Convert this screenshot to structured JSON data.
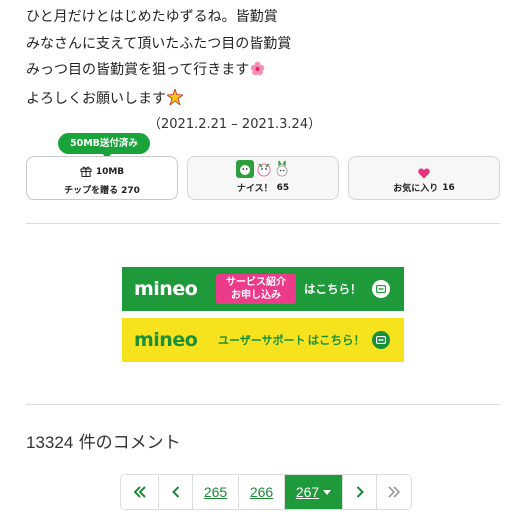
{
  "post": {
    "lines": [
      "ひと月だけとはじめたゆずるね。皆勤賞",
      "みなさんに支えて頂いたふたつ目の皆勤賞",
      "みっつ目の皆勤賞を狙って行きます",
      "よろしくお願いします"
    ],
    "period": "（2021.2.21 – 2021.3.24）"
  },
  "actions": {
    "sent_badge": "50MB送付済み",
    "tip": {
      "amount": "10MB",
      "label": "チップを贈る",
      "count": "270"
    },
    "nice": {
      "label": "ナイス！",
      "count": "65"
    },
    "favorite": {
      "label": "お気に入り",
      "count": "16"
    }
  },
  "banners": {
    "logo": "mineo",
    "service": {
      "box_line1": "サービス紹介",
      "box_line2": "お申し込み",
      "cta": "はこちら！"
    },
    "support": {
      "label": "ユーザーサポート",
      "cta": "はこちら！"
    }
  },
  "comments": {
    "count": "13324",
    "suffix": "件のコメント"
  },
  "pagination": {
    "first": "«",
    "prev": "‹",
    "pages": [
      "265",
      "266"
    ],
    "current": "267",
    "next": "›",
    "last": "»"
  },
  "colors": {
    "accent_green": "#1e9a3b",
    "pink": "#ec3b8a",
    "banner_yellow": "#f6e21d"
  },
  "icons": [
    "flower-emoji-icon",
    "sparkle-emoji-icon",
    "gift-icon",
    "nice-stamp-icons",
    "heart-icon",
    "arrow-circle-icon"
  ]
}
